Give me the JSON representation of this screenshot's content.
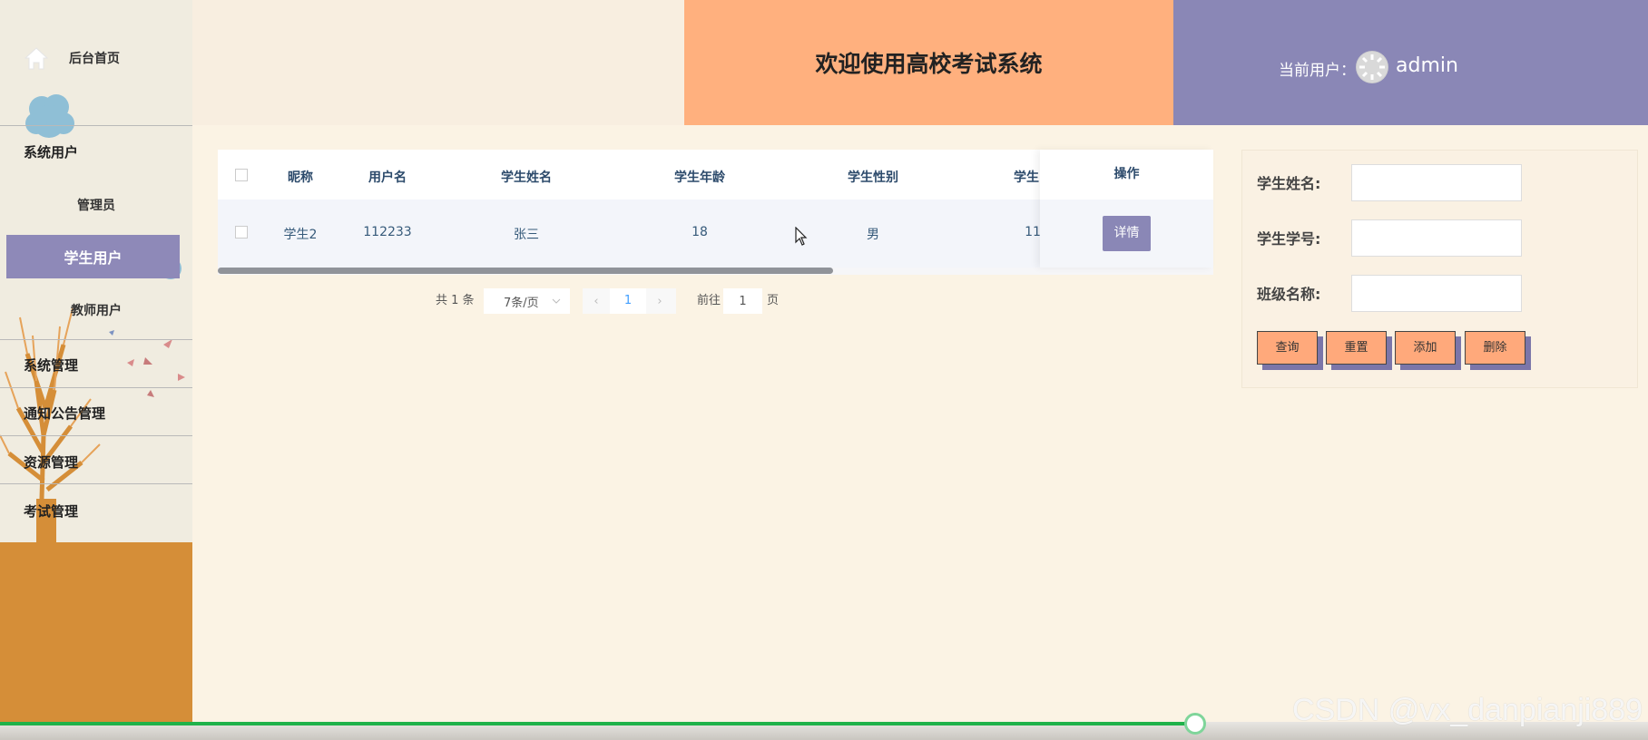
{
  "sidebar": {
    "home_label": "后台首页",
    "sections": [
      {
        "label": "系统用户"
      },
      {
        "label": "系统管理"
      },
      {
        "label": "通知公告管理"
      },
      {
        "label": "资源管理"
      },
      {
        "label": "考试管理"
      }
    ],
    "sub_items": [
      {
        "label": "管理员"
      },
      {
        "label": "学生用户",
        "active": true
      },
      {
        "label": "教师用户"
      }
    ]
  },
  "header": {
    "title": "欢迎使用高校考试系统",
    "user_caption": "当前用户：",
    "username": "admin"
  },
  "table": {
    "columns": [
      "昵称",
      "用户名",
      "学生姓名",
      "学生年龄",
      "学生性别",
      "学生"
    ],
    "rows": [
      {
        "nickname": "学生2",
        "username": "112233",
        "student_name": "张三",
        "age": "18",
        "gender": "男",
        "partial": "11"
      }
    ],
    "op_header": "操作",
    "detail_label": "详情"
  },
  "pagination": {
    "total": "共 1 条",
    "page_size": "7条/页",
    "current_page": "1",
    "goto_prefix": "前往",
    "goto_value": "1",
    "goto_suffix": "页"
  },
  "search": {
    "fields": [
      {
        "label": "学生姓名:",
        "value": ""
      },
      {
        "label": "学生学号:",
        "value": ""
      },
      {
        "label": "班级名称:",
        "value": ""
      }
    ],
    "buttons": [
      "查询",
      "重置",
      "添加",
      "删除"
    ]
  },
  "watermark": "CSDN @vx_danpianji889",
  "colors": {
    "accent_purple": "#8a87b6",
    "accent_orange": "#ffb07e",
    "progress_green": "#1fb24a"
  },
  "progress": 0.725
}
